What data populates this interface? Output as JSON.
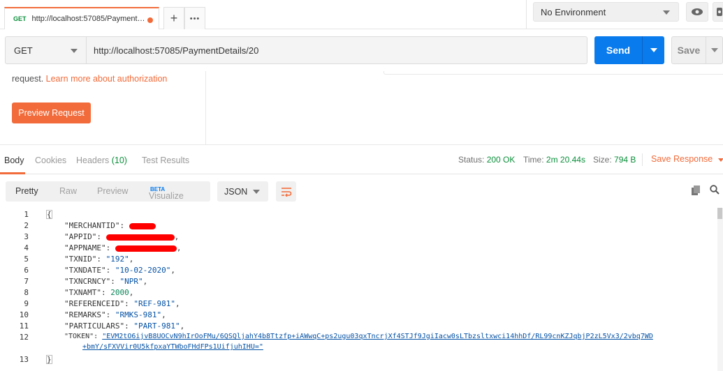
{
  "tab": {
    "method": "GET",
    "title": "http://localhost:57085/Payment…"
  },
  "tab_actions": {
    "new": "+",
    "more": "•••"
  },
  "environment": {
    "selected": "No Environment"
  },
  "request": {
    "method": "GET",
    "url": "http://localhost:57085/PaymentDetails/20",
    "send_label": "Send",
    "save_label": "Save"
  },
  "auth": {
    "text": "request. ",
    "link": "Learn more about authorization",
    "preview_label": "Preview Request"
  },
  "response": {
    "tabs": [
      "Body",
      "Cookies",
      "Headers",
      "(10)",
      "Test Results"
    ],
    "status_label": "Status:",
    "status_value": "200 OK",
    "time_label": "Time:",
    "time_value": "2m 20.44s",
    "size_label": "Size:",
    "size_value": "794 B",
    "save_response": "Save Response"
  },
  "view": {
    "modes": [
      "Pretty",
      "Raw",
      "Preview",
      "Visualize"
    ],
    "beta": "BETA",
    "format": "JSON"
  },
  "body": {
    "line_numbers": [
      "1",
      "2",
      "3",
      "4",
      "5",
      "6",
      "7",
      "8",
      "9",
      "10",
      "11",
      "12",
      "13"
    ],
    "open": "{",
    "close": "}",
    "k_merchantid": "\"MERCHANTID\"",
    "k_appid": "\"APPID\"",
    "k_appname": "\"APPNAME\"",
    "k_txnid": "\"TXNID\"",
    "v_txnid": "\"192\"",
    "k_txndate": "\"TXNDATE\"",
    "v_txndate": "\"10-02-2020\"",
    "k_txncrncy": "\"TXNCRNCY\"",
    "v_txncrncy": "\"NPR\"",
    "k_txnamt": "\"TXNAMT\"",
    "v_txnamt": "2000",
    "k_referenceid": "\"REFERENCEID\"",
    "v_referenceid": "\"REF-981\"",
    "k_remarks": "\"REMARKS\"",
    "v_remarks": "\"RMKS-981\"",
    "k_particulars": "\"PARTICULARS\"",
    "v_particulars": "\"PART-981\"",
    "k_token": "\"TOKEN\"",
    "v_token_1": "\"EVM2tO6ijvB8UOCvN9hIrOoFMu/6QSQljahY4b8Ttzfp+iAWwqC+ps2ugu03qxTncrjXf4STJf9JgiIacw0sLTbzsltxwci14hhDf/RL99cnKZJqbjP2zL5Vx3/2vbq7WD",
    "v_token_2": "+bmY/sFXVVir0U5kfpxaYTWboFHdFPs1UifjuhIHU=\""
  }
}
